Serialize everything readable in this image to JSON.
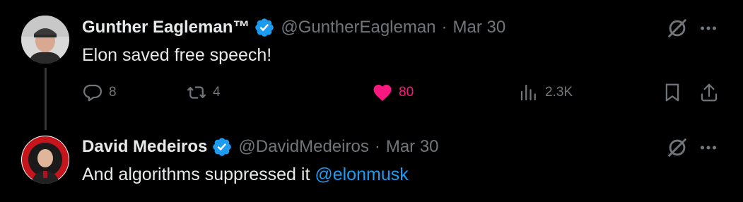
{
  "tweets": [
    {
      "name": "Gunther Eagleman™",
      "handle": "@GuntherEagleman",
      "separator": "·",
      "date": "Mar 30",
      "text": "Elon saved free speech!",
      "replies": "8",
      "retweets": "4",
      "likes": "80",
      "views": "2.3K",
      "liked": true
    },
    {
      "name": "David Medeiros",
      "handle": "@DavidMedeiros",
      "separator": "·",
      "date": "Mar 30",
      "text": "And algorithms suppressed it ",
      "mention": "@elonmusk"
    }
  ],
  "colors": {
    "background": "#000000",
    "text": "#e7e9ea",
    "muted": "#71767b",
    "verified": "#1d9bf0",
    "like": "#f91880",
    "link": "#1d9bf0"
  },
  "icons": [
    "verified-badge-icon",
    "grok-icon",
    "more-icon",
    "reply-icon",
    "retweet-icon",
    "heart-icon",
    "views-icon",
    "bookmark-icon",
    "share-icon"
  ]
}
